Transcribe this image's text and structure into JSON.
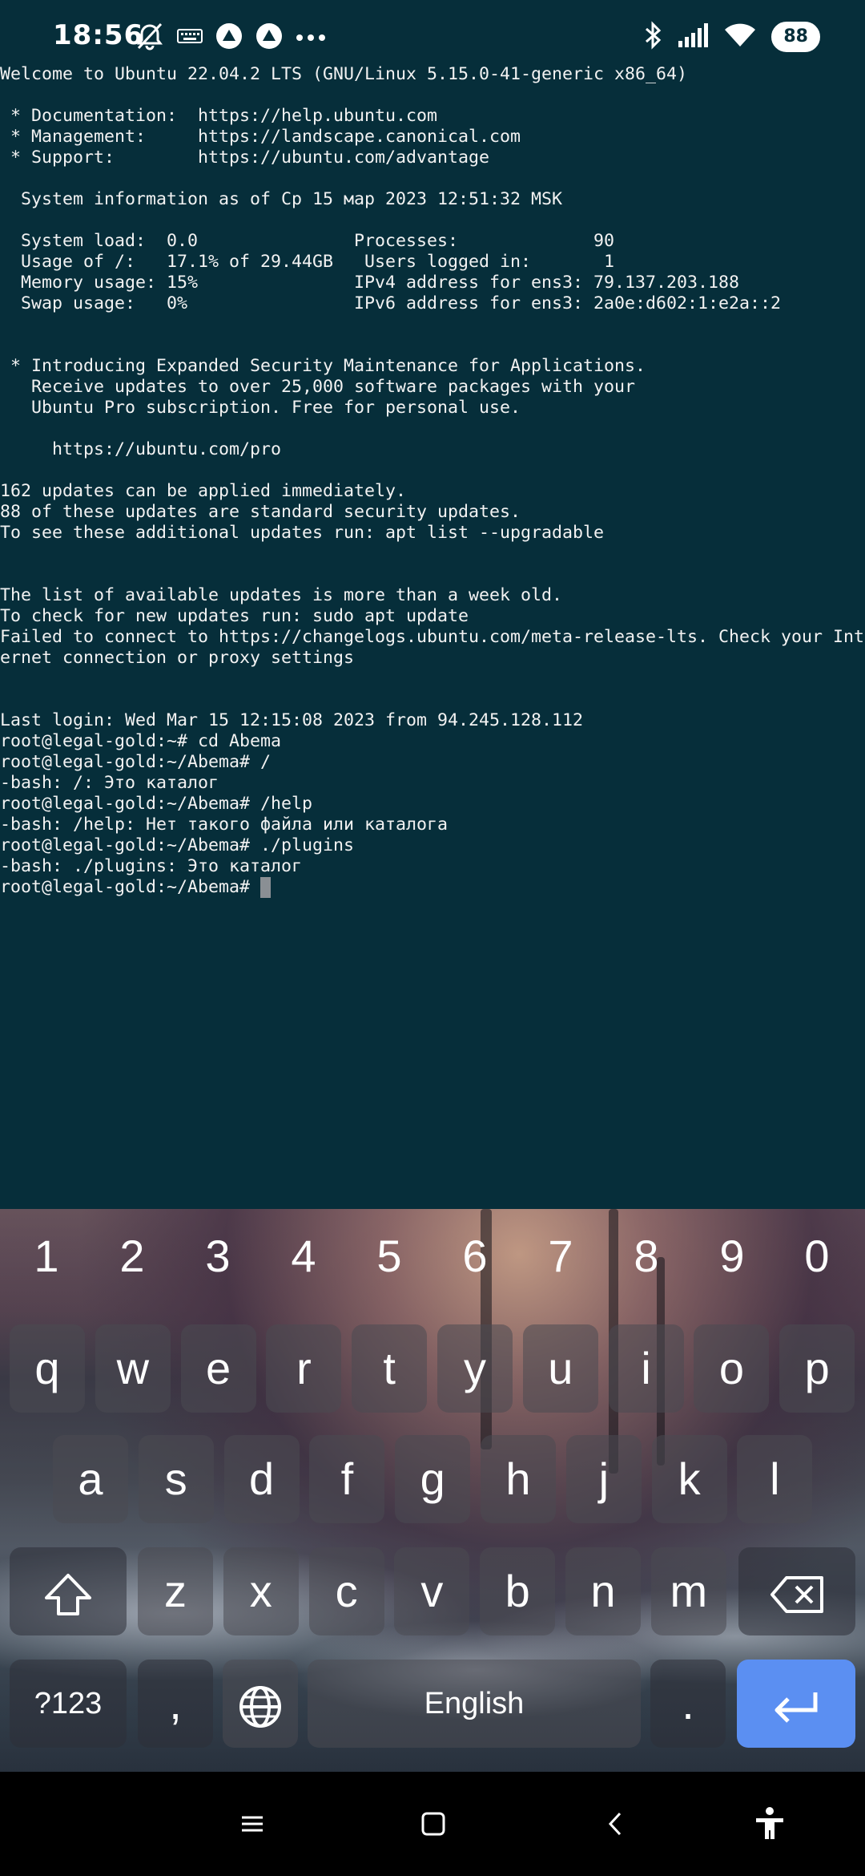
{
  "status_bar": {
    "time": "18:56",
    "battery_level": "88",
    "icons_left": [
      "alarm-off-icon",
      "keyboard-icon",
      "app-icon-1",
      "app-icon-2",
      "more-dots-icon"
    ],
    "icons_right": [
      "bluetooth-icon",
      "signal-icon",
      "wifi-icon",
      "battery-icon"
    ]
  },
  "terminal": {
    "lines": [
      "Welcome to Ubuntu 22.04.2 LTS (GNU/Linux 5.15.0-41-generic x86_64)",
      "",
      " * Documentation:  https://help.ubuntu.com",
      " * Management:     https://landscape.canonical.com",
      " * Support:        https://ubuntu.com/advantage",
      "",
      "  System information as of Ср 15 мар 2023 12:51:32 MSK",
      "",
      "  System load:  0.0               Processes:             90",
      "  Usage of /:   17.1% of 29.44GB   Users logged in:       1",
      "  Memory usage: 15%               IPv4 address for ens3: 79.137.203.188",
      "  Swap usage:   0%                IPv6 address for ens3: 2a0e:d602:1:e2a::2",
      "",
      "",
      " * Introducing Expanded Security Maintenance for Applications.",
      "   Receive updates to over 25,000 software packages with your",
      "   Ubuntu Pro subscription. Free for personal use.",
      "",
      "     https://ubuntu.com/pro",
      "",
      "162 updates can be applied immediately.",
      "88 of these updates are standard security updates.",
      "To see these additional updates run: apt list --upgradable",
      "",
      "",
      "The list of available updates is more than a week old.",
      "To check for new updates run: sudo apt update",
      "Failed to connect to https://changelogs.ubuntu.com/meta-release-lts. Check your Int",
      "ernet connection or proxy settings",
      "",
      "",
      "Last login: Wed Mar 15 12:15:08 2023 from 94.245.128.112",
      "root@legal-gold:~# cd Abema",
      "root@legal-gold:~/Abema# /",
      "-bash: /: Это каталог",
      "root@legal-gold:~/Abema# /help",
      "-bash: /help: Нет такого файла или каталога",
      "root@legal-gold:~/Abema# ./plugins",
      "-bash: ./plugins: Это каталог"
    ],
    "prompt": "root@legal-gold:~/Abema# "
  },
  "keyboard": {
    "numbers": [
      "1",
      "2",
      "3",
      "4",
      "5",
      "6",
      "7",
      "8",
      "9",
      "0"
    ],
    "row1": [
      "q",
      "w",
      "e",
      "r",
      "t",
      "y",
      "u",
      "i",
      "o",
      "p"
    ],
    "row2": [
      "a",
      "s",
      "d",
      "f",
      "g",
      "h",
      "j",
      "k",
      "l"
    ],
    "row3": [
      "z",
      "x",
      "c",
      "v",
      "b",
      "n",
      "m"
    ],
    "symbols_label": "?123",
    "comma": ",",
    "space_label": "English",
    "period": "."
  },
  "nav_bar": {
    "icons": [
      "menu-icon",
      "home-icon",
      "back-icon",
      "accessibility-icon"
    ]
  }
}
